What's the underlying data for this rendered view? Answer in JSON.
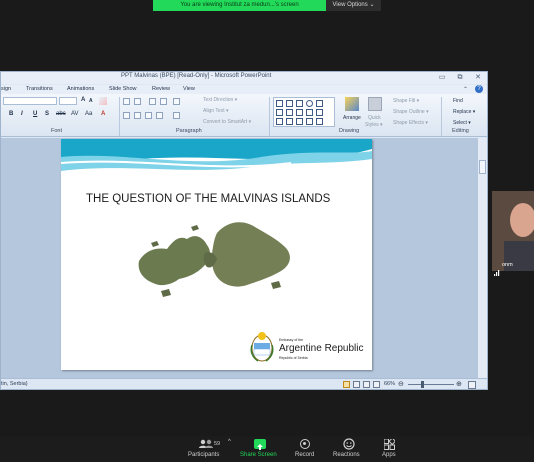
{
  "share_banner": {
    "text": "You are viewing Institut za medun...'s screen",
    "view_options": "View Options ⌄"
  },
  "window": {
    "title": "PPT Malvinas (BPE) [Read-Only] - Microsoft PowerPoint",
    "controls": [
      "▭",
      "⧉",
      "✕"
    ]
  },
  "ribbon": {
    "tabs": [
      "sign",
      "Transitions",
      "Animations",
      "Slide Show",
      "Review",
      "View"
    ],
    "groups": {
      "font": "Font",
      "paragraph": "Paragraph",
      "drawing": "Drawing",
      "editing": "Editing"
    },
    "paragraph_items": [
      "Text Direction ▾",
      "Align Text ▾",
      "Convert to SmartArt ▾"
    ],
    "drawing_items": {
      "arrange": "Arrange",
      "quick_styles_1": "Quick",
      "quick_styles_2": "Styles ▾",
      "shape_fill": "Shape Fill ▾",
      "shape_outline": "Shape Outline ▾",
      "shape_effects": "Shape Effects ▾"
    },
    "editing_items": [
      "Find",
      "Replace ▾",
      "Select ▾"
    ],
    "format_buttons": [
      "B",
      "I",
      "U",
      "S",
      "abc",
      "AV",
      "Aa",
      "A"
    ]
  },
  "slide": {
    "title": "THE QUESTION OF THE MALVINAS ISLANDS",
    "embassy_of_the": "Embassy of the",
    "argentine_republic": "Argentine Republic",
    "republic_of_serbia": "Republic of Serbia"
  },
  "status_bar": {
    "language": "tin, Serbia)",
    "zoom": "66%",
    "minus": "⊖",
    "plus": "⊕"
  },
  "participant": {
    "name": "onm"
  },
  "toolbar": {
    "participants_count": "59",
    "participants": "Participants",
    "share_screen": "Share Screen",
    "record": "Record",
    "reactions": "Reactions",
    "apps": "Apps"
  },
  "colors": {
    "share_green": "#23d959",
    "toolbar_bg": "#1c1c1c",
    "ribbon_blue": "#dbe5f1",
    "slide_wave": "#1aa6c8"
  }
}
